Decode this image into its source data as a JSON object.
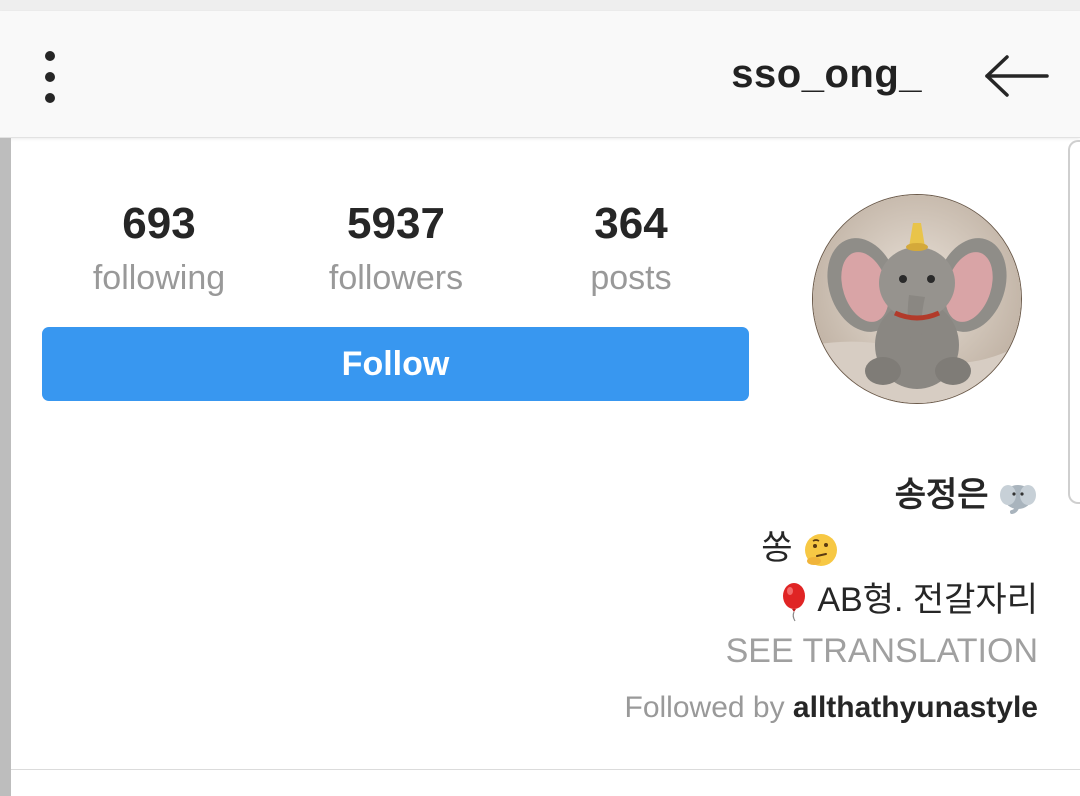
{
  "header": {
    "username": "sso_ong_"
  },
  "stats": [
    {
      "value": "693",
      "label": "following"
    },
    {
      "value": "5937",
      "label": "followers"
    },
    {
      "value": "364",
      "label": "posts"
    }
  ],
  "follow_button": {
    "label": "Follow"
  },
  "bio": {
    "name": "송정은",
    "line2": "쏭",
    "line3": "AB형. 전갈자리",
    "see_translation": "SEE TRANSLATION",
    "followed_by_prefix": "Followed by",
    "followed_by_user": "allthathyunastyle"
  },
  "icons": {
    "menu": "more-vertical-icon",
    "back": "arrow-left-icon",
    "elephant": "elephant-emoji",
    "thinking": "thinking-face-emoji",
    "balloon": "red-balloon-emoji"
  },
  "colors": {
    "follow_button": "#3897f0",
    "text_primary": "#262626",
    "text_secondary": "#999999"
  }
}
